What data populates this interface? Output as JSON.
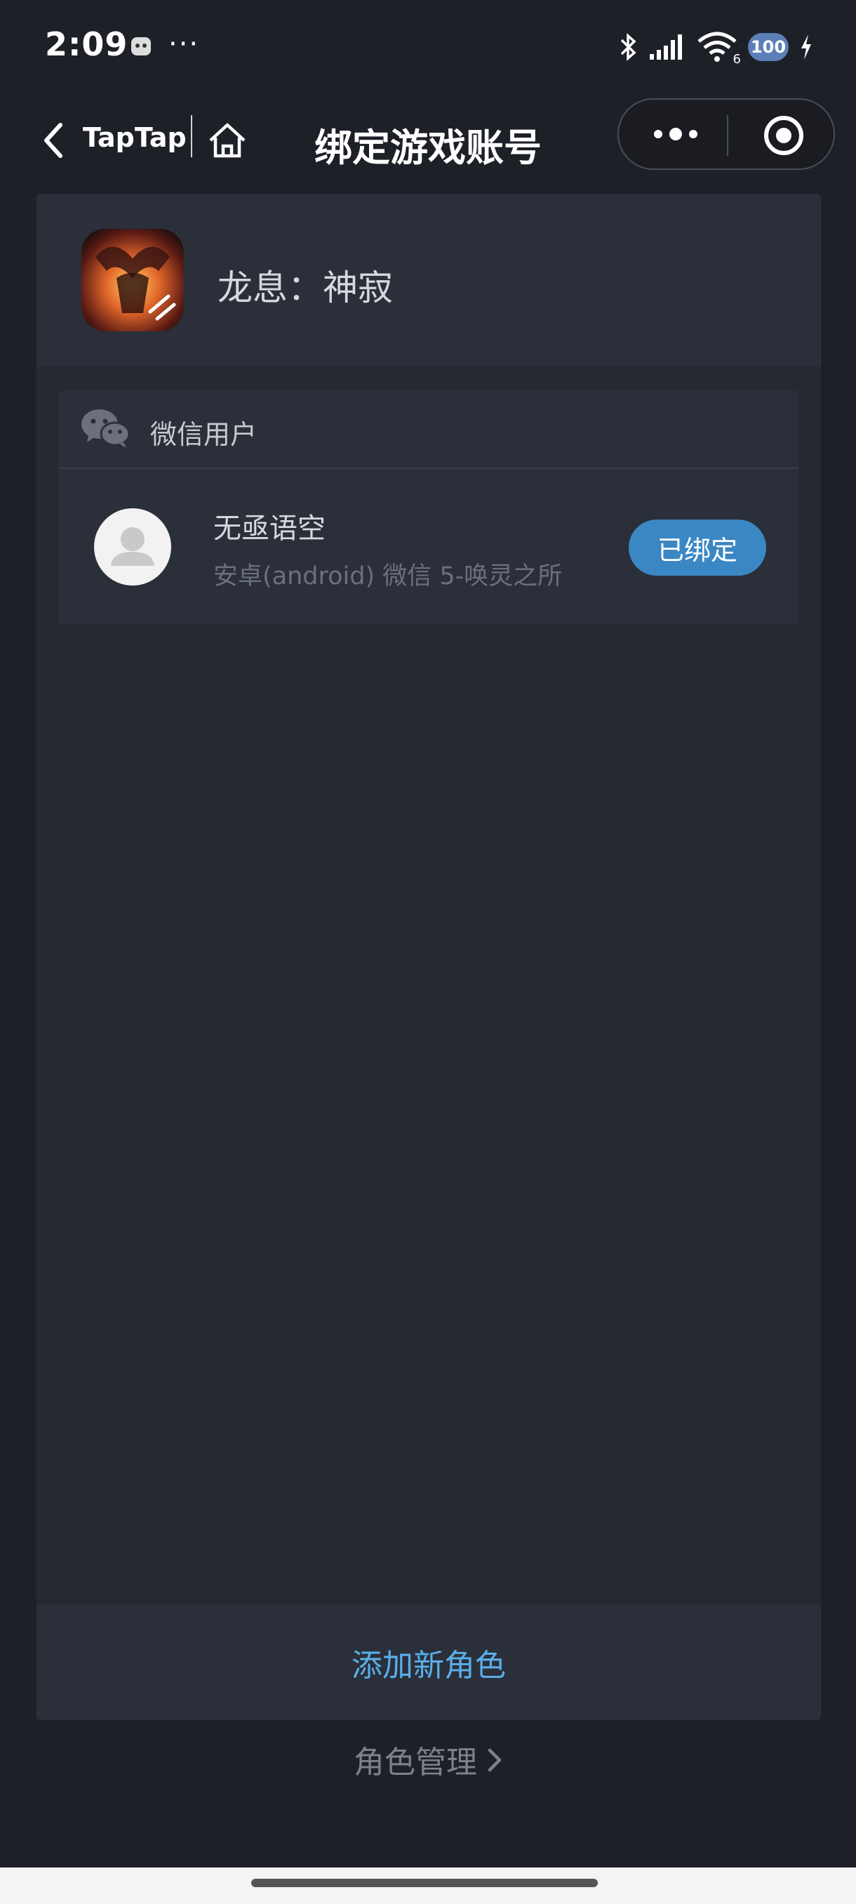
{
  "status_bar": {
    "time": "2:09",
    "more": "···",
    "network_label": "6",
    "battery": "100",
    "icons": [
      "bluetooth-icon",
      "signal-icon",
      "wifi-icon",
      "battery-icon",
      "charging-icon"
    ]
  },
  "nav": {
    "back_label": "TapTap",
    "title": "绑定游戏账号"
  },
  "game": {
    "name": "龙息：神寂"
  },
  "account": {
    "type_label": "微信用户",
    "role_name": "无亟语空",
    "role_meta": "安卓(android) 微信 5-唤灵之所",
    "bound_label": "已绑定"
  },
  "actions": {
    "add_role": "添加新角色",
    "manage_roles": "角色管理"
  },
  "colors": {
    "accent": "#3b87c4",
    "link": "#5aaee8",
    "background": "#1e2028",
    "panel": "#252932"
  }
}
